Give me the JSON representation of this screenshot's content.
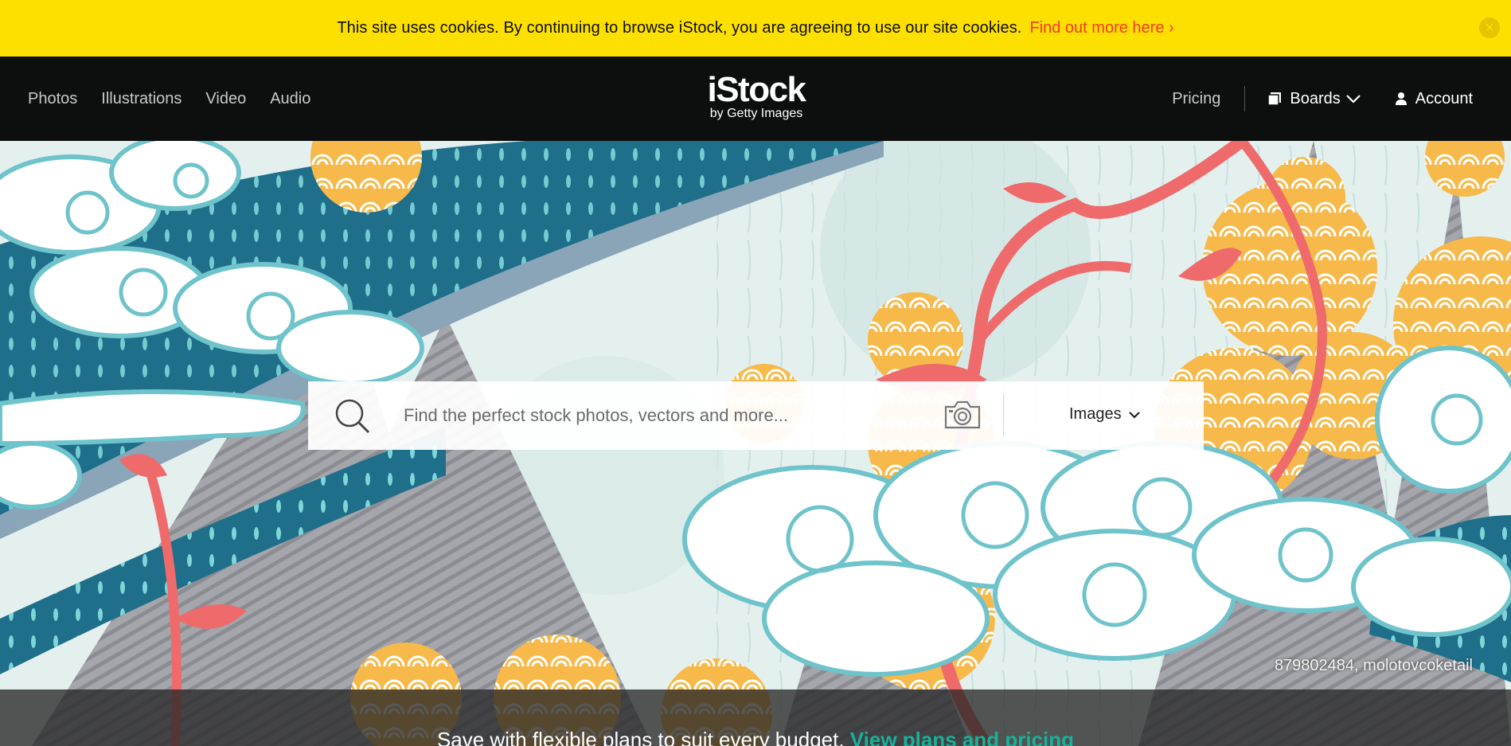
{
  "cookie_bar": {
    "message": "This site uses cookies. By continuing to browse iStock, you are agreeing to use our site cookies.",
    "link": "Find out more here ›",
    "close_icon": "close-icon"
  },
  "nav": {
    "left_items": [
      "Photos",
      "Illustrations",
      "Video",
      "Audio"
    ],
    "logo_main": "iStock",
    "logo_sub": "by Getty Images",
    "pricing": "Pricing",
    "boards": "Boards",
    "account": "Account"
  },
  "search": {
    "placeholder": "Find the perfect stock photos, vectors and more...",
    "type_selected": "Images"
  },
  "hero": {
    "credit": "879802484, molotovcoketail"
  },
  "promo": {
    "text": "Save with flexible plans to suit every budget.",
    "link": "View plans and pricing"
  },
  "colors": {
    "cookie_yellow": "#fddf00",
    "link_red": "#ef3b2a",
    "nav_black": "#0d0e0e",
    "promo_teal": "#18b19a"
  }
}
